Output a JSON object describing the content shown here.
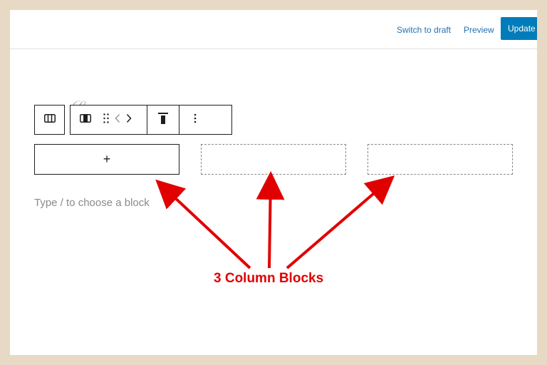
{
  "header": {
    "switch_to_draft": "Switch to draft",
    "preview": "Preview",
    "update": "Update"
  },
  "editor": {
    "add_block_symbol": "+",
    "placeholder": "Type / to choose a block"
  },
  "toolbar": {
    "icons": [
      "columns-icon",
      "column-icon",
      "drag-handle-icon",
      "move-arrows-icon",
      "align-top-icon",
      "more-options-icon"
    ]
  },
  "annotation": {
    "label": "3 Column Blocks"
  },
  "colors": {
    "accent": "#007cba",
    "link": "#2271b1",
    "annotation_red": "#e00000",
    "background": "#e8d9c4"
  }
}
